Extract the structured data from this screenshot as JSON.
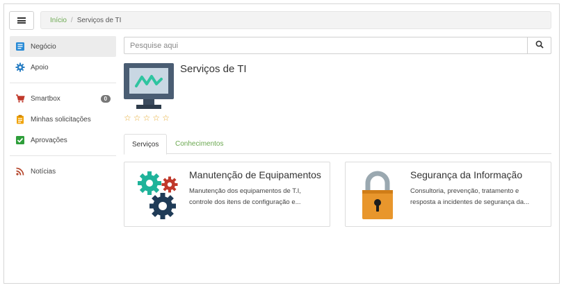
{
  "breadcrumb": {
    "home": "Início",
    "separator": "/",
    "current": "Serviços de TI"
  },
  "sidebar": {
    "items": [
      {
        "label": "Negócio",
        "icon": "book-icon",
        "active": true
      },
      {
        "label": "Apoio",
        "icon": "gear-icon"
      },
      {
        "label": "Smartbox",
        "icon": "cart-icon",
        "badge": "0"
      },
      {
        "label": "Minhas solicitações",
        "icon": "clipboard-icon"
      },
      {
        "label": "Aprovações",
        "icon": "check-icon"
      },
      {
        "label": "Notícias",
        "icon": "rss-icon"
      }
    ]
  },
  "search": {
    "placeholder": "Pesquise aqui",
    "value": ""
  },
  "page": {
    "title": "Serviços de TI",
    "rating": 0,
    "rating_max": 5
  },
  "tabs": [
    {
      "label": "Serviços",
      "active": true
    },
    {
      "label": "Conhecimentos",
      "active": false
    }
  ],
  "cards": [
    {
      "title": "Manutenção de Equipamentos",
      "description": "Manutenção dos equipamentos de T.I, controle dos itens de configuração e...",
      "icon": "gears-icon"
    },
    {
      "title": "Segurança da Informação",
      "description": "Consultoria, prevenção, tratamento e resposta a incidentes de segurança da...",
      "icon": "padlock-icon"
    }
  ],
  "colors": {
    "accent_green": "#6aa84f",
    "star": "#e5a930",
    "monitor": "#4a5d73",
    "screen_line": "#2ec4a0"
  }
}
